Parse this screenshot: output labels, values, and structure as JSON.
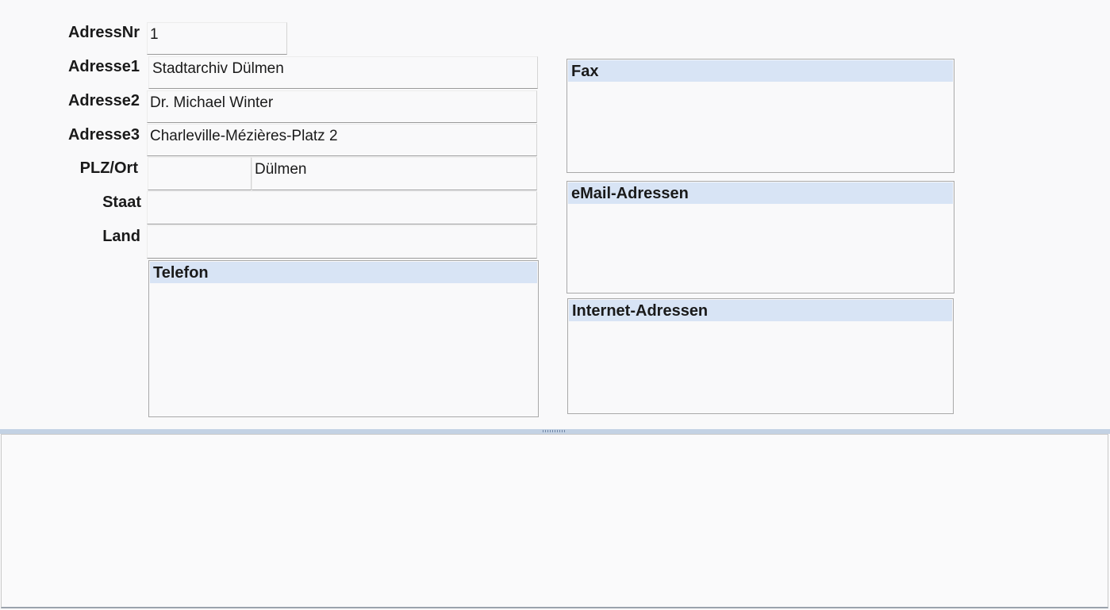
{
  "form": {
    "adressnr": {
      "label": "AdressNr",
      "value": "1"
    },
    "adresse1": {
      "label": "Adresse1",
      "value": "Stadtarchiv Dülmen"
    },
    "adresse2": {
      "label": "Adresse2",
      "value": "Dr. Michael Winter"
    },
    "adresse3": {
      "label": "Adresse3",
      "value": "Charleville-Mézières-Platz 2"
    },
    "plz_ort": {
      "label": "PLZ/Ort",
      "plz": "",
      "ort": "Dülmen"
    },
    "staat": {
      "label": "Staat",
      "value": ""
    },
    "land": {
      "label": "Land",
      "value": ""
    }
  },
  "lists": {
    "telefon": {
      "title": "Telefon",
      "items": []
    },
    "fax": {
      "title": "Fax",
      "items": []
    },
    "email": {
      "title": "eMail-Adressen",
      "items": []
    },
    "internet": {
      "title": "Internet-Adressen",
      "items": []
    }
  },
  "colors": {
    "background": "#f9f9fa",
    "list_header": "#d8e4f5",
    "splitter": "#c3d2e4"
  }
}
